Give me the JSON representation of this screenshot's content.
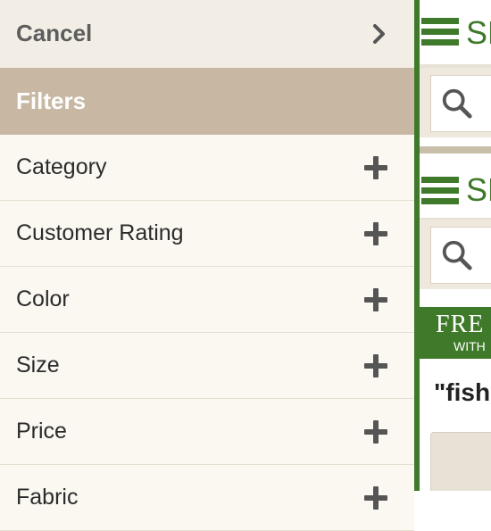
{
  "drawer": {
    "cancel_label": "Cancel",
    "cancel_icon": "chevron-right-icon",
    "filters_heading": "Filters",
    "filters": [
      {
        "label": "Category",
        "icon": "plus-icon"
      },
      {
        "label": "Customer Rating",
        "icon": "plus-icon"
      },
      {
        "label": "Color",
        "icon": "plus-icon"
      },
      {
        "label": "Size",
        "icon": "plus-icon"
      },
      {
        "label": "Price",
        "icon": "plus-icon"
      },
      {
        "label": "Fabric",
        "icon": "plus-icon"
      }
    ]
  },
  "background_page": {
    "logo_text": "SH",
    "banner_big": "FRE",
    "banner_small": "WITH",
    "query_text": "\"fish"
  },
  "colors": {
    "brand_green": "#3f7a2a",
    "filters_header_bg": "#c8b8a3",
    "drawer_bg": "#fbf8f2",
    "cancel_bg": "#f3eee5"
  }
}
